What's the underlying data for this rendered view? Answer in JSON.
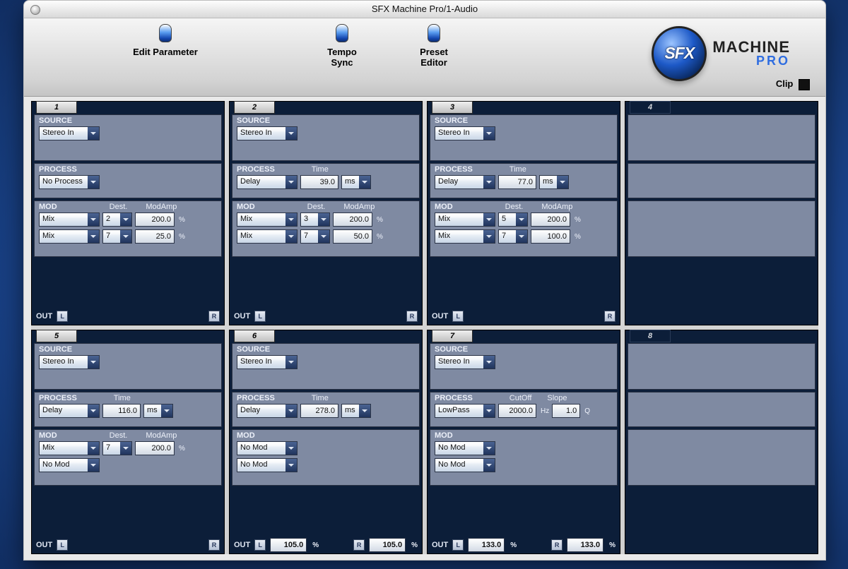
{
  "window_title": "SFX Machine Pro/1-Audio",
  "toolbar": {
    "edit_parameter": "Edit Parameter",
    "tempo_sync": "Tempo\nSync",
    "preset_editor": "Preset\nEditor",
    "clip": "Clip"
  },
  "logo": {
    "sfx": "SFX",
    "machine": "MACHINE",
    "pro": "PRO"
  },
  "labels": {
    "source": "SOURCE",
    "process": "PROCESS",
    "mod": "MOD",
    "out": "OUT",
    "time": "Time",
    "dest": "Dest.",
    "modamp": "ModAmp",
    "cutoff": "CutOff",
    "slope": "Slope",
    "ms": "ms",
    "hz": "Hz",
    "q": "Q",
    "pct": "%",
    "L": "L",
    "R": "R"
  },
  "modules": [
    {
      "n": "1",
      "active": true,
      "source": "Stereo In",
      "process": {
        "type": "No Process"
      },
      "mods": [
        {
          "type": "Mix",
          "dest": "2",
          "amp": "200.0"
        },
        {
          "type": "Mix",
          "dest": "7",
          "amp": "25.0"
        }
      ],
      "out": {
        "L": "",
        "R": ""
      }
    },
    {
      "n": "2",
      "active": true,
      "source": "Stereo In",
      "process": {
        "type": "Delay",
        "p1_label": "Time",
        "p1": "39.0",
        "p1_unit": "ms"
      },
      "mods": [
        {
          "type": "Mix",
          "dest": "3",
          "amp": "200.0"
        },
        {
          "type": "Mix",
          "dest": "7",
          "amp": "50.0"
        }
      ],
      "out": {
        "L": "",
        "R": ""
      }
    },
    {
      "n": "3",
      "active": true,
      "source": "Stereo In",
      "process": {
        "type": "Delay",
        "p1_label": "Time",
        "p1": "77.0",
        "p1_unit": "ms"
      },
      "mods": [
        {
          "type": "Mix",
          "dest": "5",
          "amp": "200.0"
        },
        {
          "type": "Mix",
          "dest": "7",
          "amp": "100.0"
        }
      ],
      "out": {
        "L": "",
        "R": ""
      }
    },
    {
      "n": "4",
      "active": false
    },
    {
      "n": "5",
      "active": true,
      "source": "Stereo In",
      "process": {
        "type": "Delay",
        "p1_label": "Time",
        "p1": "116.0",
        "p1_unit": "ms"
      },
      "mods": [
        {
          "type": "Mix",
          "dest": "7",
          "amp": "200.0"
        },
        {
          "type": "No Mod"
        }
      ],
      "out": {
        "L": "",
        "R": ""
      }
    },
    {
      "n": "6",
      "active": true,
      "source": "Stereo In",
      "process": {
        "type": "Delay",
        "p1_label": "Time",
        "p1": "278.0",
        "p1_unit": "ms"
      },
      "mods": [
        {
          "type": "No Mod"
        },
        {
          "type": "No Mod"
        }
      ],
      "out": {
        "L": "105.0",
        "R": "105.0"
      }
    },
    {
      "n": "7",
      "active": true,
      "source": "Stereo In",
      "process": {
        "type": "LowPass",
        "p1_label": "CutOff",
        "p1": "2000.0",
        "p1_unit": "Hz",
        "p2_label": "Slope",
        "p2": "1.0",
        "p2_unit": "Q"
      },
      "mods": [
        {
          "type": "No Mod"
        },
        {
          "type": "No Mod"
        }
      ],
      "out": {
        "L": "133.0",
        "R": "133.0"
      }
    },
    {
      "n": "8",
      "active": false
    }
  ]
}
